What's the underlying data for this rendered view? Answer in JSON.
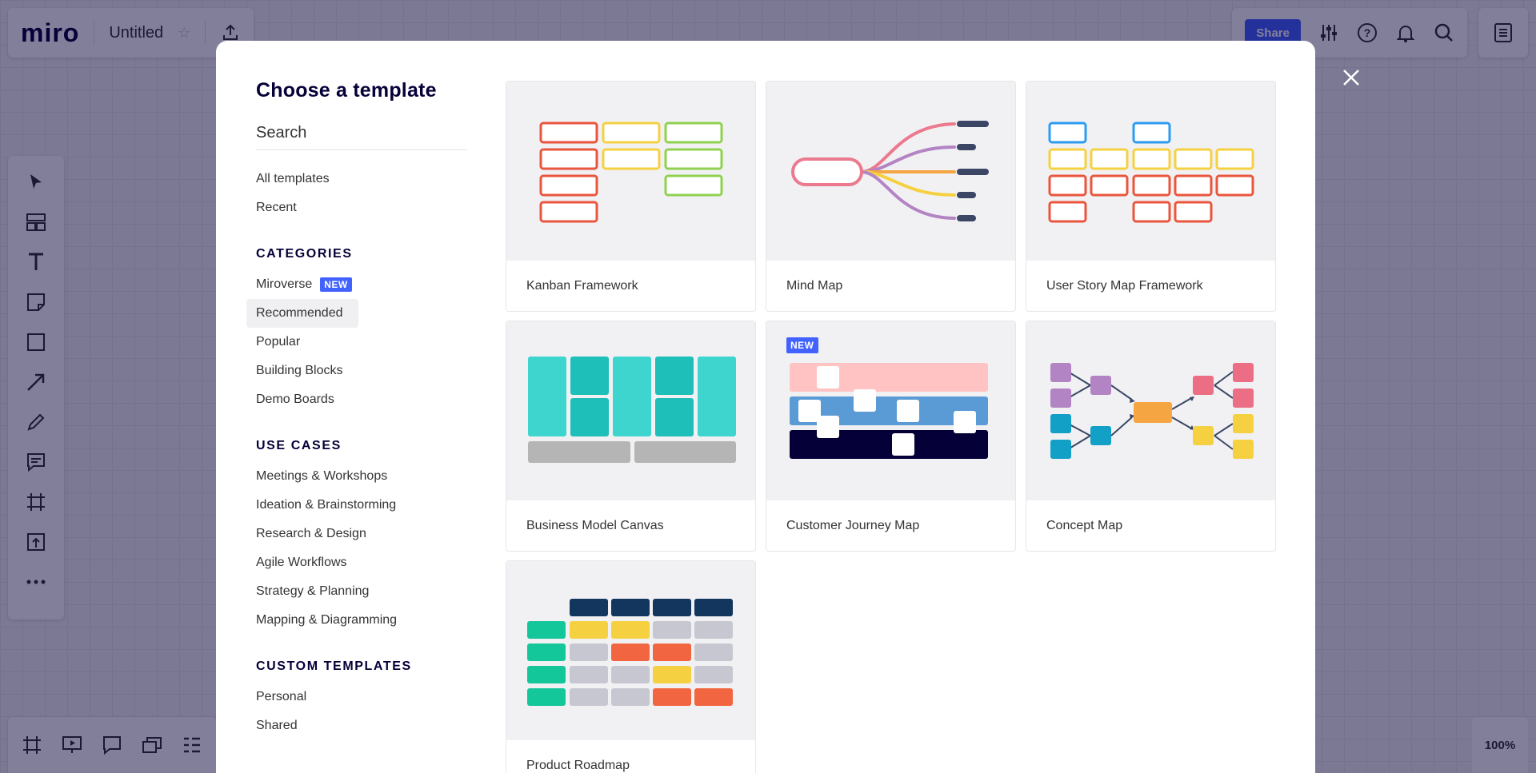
{
  "app": {
    "logo": "miro",
    "board_title": "Untitled",
    "share_label": "Share",
    "zoom": "100%"
  },
  "modal": {
    "title": "Choose a template",
    "search_placeholder": "Search",
    "nav_top": [
      {
        "label": "All templates"
      },
      {
        "label": "Recent"
      }
    ],
    "categories_title": "CATEGORIES",
    "categories": [
      {
        "label": "Miroverse",
        "badge": "NEW"
      },
      {
        "label": "Recommended",
        "active": true
      },
      {
        "label": "Popular"
      },
      {
        "label": "Building Blocks"
      },
      {
        "label": "Demo Boards"
      }
    ],
    "use_cases_title": "USE CASES",
    "use_cases": [
      {
        "label": "Meetings & Workshops"
      },
      {
        "label": "Ideation & Brainstorming"
      },
      {
        "label": "Research & Design"
      },
      {
        "label": "Agile Workflows"
      },
      {
        "label": "Strategy & Planning"
      },
      {
        "label": "Mapping & Diagramming"
      }
    ],
    "custom_title": "CUSTOM TEMPLATES",
    "custom": [
      {
        "label": "Personal"
      },
      {
        "label": "Shared"
      }
    ],
    "templates": [
      {
        "label": "Kanban Framework",
        "thumb": "kanban"
      },
      {
        "label": "Mind Map",
        "thumb": "mindmap"
      },
      {
        "label": "User Story Map Framework",
        "thumb": "storymap"
      },
      {
        "label": "Business Model Canvas",
        "thumb": "bmc"
      },
      {
        "label": "Customer Journey Map",
        "thumb": "cjm",
        "badge": "NEW"
      },
      {
        "label": "Concept Map",
        "thumb": "concept"
      },
      {
        "label": "Product Roadmap",
        "thumb": "roadmap"
      }
    ]
  },
  "colors": {
    "accent": "#4262ff",
    "overlay": "rgba(5,0,56,0.5)",
    "red": "#e9553d",
    "yellow": "#f5d142",
    "green": "#8fd14f",
    "blue": "#2d9bf0",
    "teal": "#3fd5cf",
    "navy": "#12365e"
  }
}
